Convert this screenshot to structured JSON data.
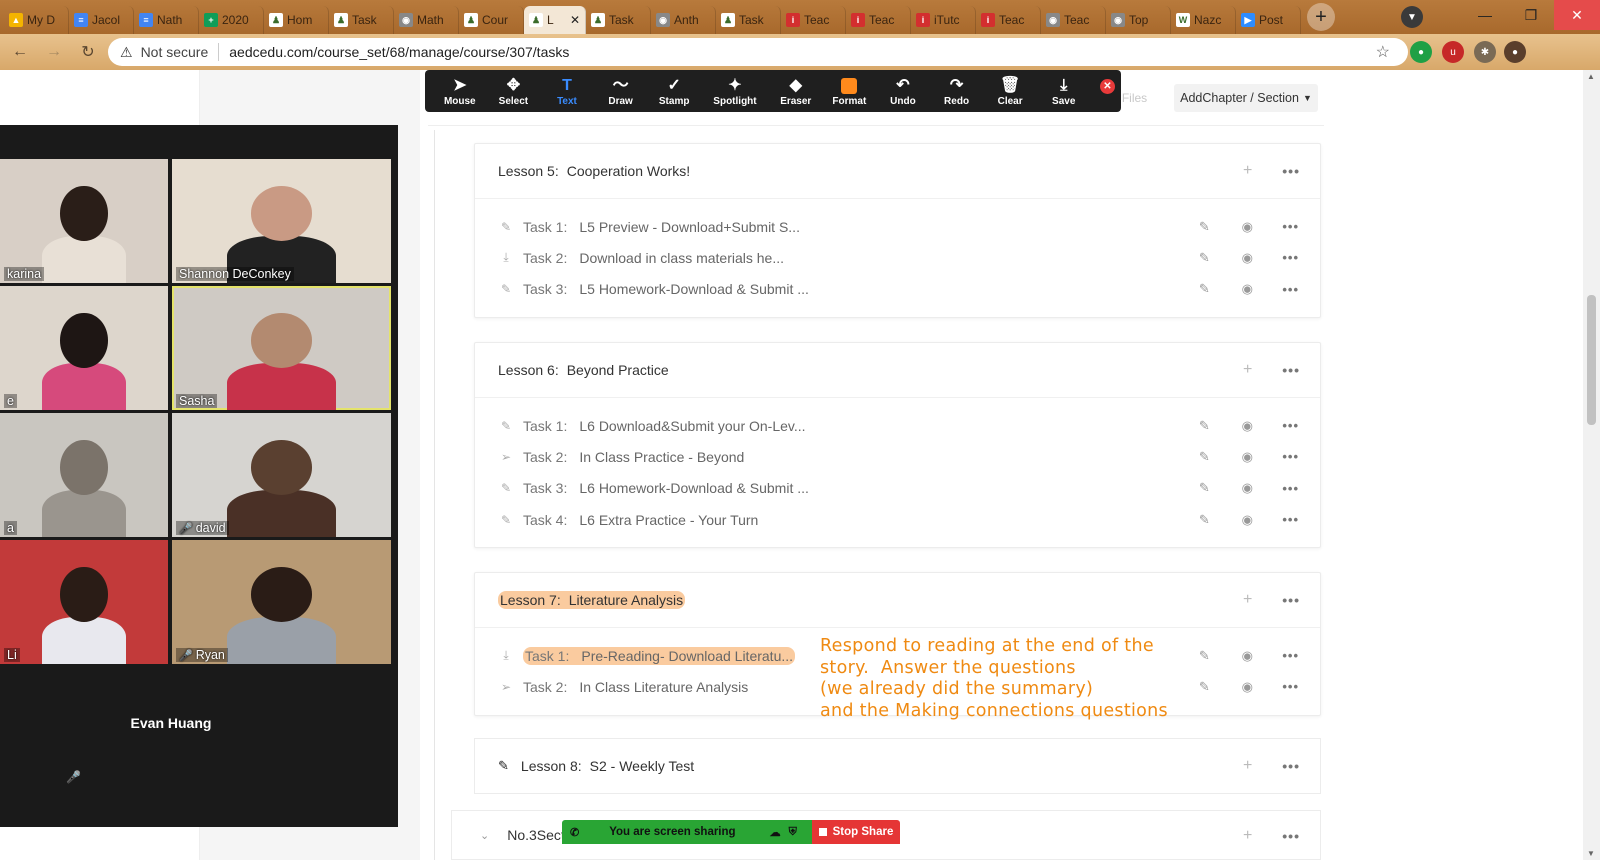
{
  "browser": {
    "tabs": [
      {
        "title": "My D",
        "favicon_color": "#f4b400",
        "favicon_glyph": "▲"
      },
      {
        "title": "Jacol",
        "favicon_color": "#4285f4",
        "favicon_glyph": "≡"
      },
      {
        "title": "Nath",
        "favicon_color": "#4285f4",
        "favicon_glyph": "≡"
      },
      {
        "title": "2020",
        "favicon_color": "#0f9d58",
        "favicon_glyph": "+"
      },
      {
        "title": "Hom",
        "favicon_color": "#ffffff",
        "favicon_glyph": "♟"
      },
      {
        "title": "Task",
        "favicon_color": "#ffffff",
        "favicon_glyph": "♟"
      },
      {
        "title": "Math",
        "favicon_color": "#888888",
        "favicon_glyph": "◉"
      },
      {
        "title": "Cour",
        "favicon_color": "#ffffff",
        "favicon_glyph": "♟"
      },
      {
        "title": "L",
        "favicon_color": "#ffffff",
        "favicon_glyph": "♟",
        "active": true
      },
      {
        "title": "Task",
        "favicon_color": "#ffffff",
        "favicon_glyph": "♟"
      },
      {
        "title": "Anth",
        "favicon_color": "#888888",
        "favicon_glyph": "◉"
      },
      {
        "title": "Task",
        "favicon_color": "#ffffff",
        "favicon_glyph": "♟"
      },
      {
        "title": "Teac",
        "favicon_color": "#d32f2f",
        "favicon_glyph": "i"
      },
      {
        "title": "Teac",
        "favicon_color": "#d32f2f",
        "favicon_glyph": "i"
      },
      {
        "title": "iTutc",
        "favicon_color": "#d32f2f",
        "favicon_glyph": "i"
      },
      {
        "title": "Teac",
        "favicon_color": "#d32f2f",
        "favicon_glyph": "i"
      },
      {
        "title": "Teac",
        "favicon_color": "#888888",
        "favicon_glyph": "◉"
      },
      {
        "title": "Top",
        "favicon_color": "#888888",
        "favicon_glyph": "◉"
      },
      {
        "title": "Nazc",
        "favicon_color": "#ffffff",
        "favicon_glyph": "W"
      },
      {
        "title": "Post",
        "favicon_color": "#2d8cff",
        "favicon_glyph": "▶"
      }
    ],
    "new_tab": "+",
    "not_secure": "Not secure",
    "url": "aedcedu.com/course_set/68/manage/course/307/tasks"
  },
  "annotate_toolbar": {
    "tools": [
      {
        "label": "Mouse",
        "icon": "cursor-icon",
        "glyph": "➤"
      },
      {
        "label": "Select",
        "icon": "move-icon",
        "glyph": "✥"
      },
      {
        "label": "Text",
        "icon": "text-icon",
        "glyph": "T",
        "active": true
      },
      {
        "label": "Draw",
        "icon": "squiggle-icon",
        "glyph": "〜"
      },
      {
        "label": "Stamp",
        "icon": "check-icon",
        "glyph": "✓"
      },
      {
        "label": "Spotlight",
        "icon": "wand-icon",
        "glyph": "✦"
      },
      {
        "label": "Eraser",
        "icon": "eraser-icon",
        "glyph": "◆"
      },
      {
        "label": "Format",
        "icon": "format-icon",
        "glyph": "",
        "color": "#ff8a1c"
      },
      {
        "label": "Undo",
        "icon": "undo-icon",
        "glyph": "↶"
      },
      {
        "label": "Redo",
        "icon": "redo-icon",
        "glyph": "↷"
      },
      {
        "label": "Clear",
        "icon": "trash-icon",
        "glyph": "🗑"
      },
      {
        "label": "Save",
        "icon": "save-icon",
        "glyph": "⤓"
      }
    ]
  },
  "header": {
    "files_label": "Files",
    "add_chapter_label": "AddChapter / Section"
  },
  "lessons": [
    {
      "num": "Lesson 5:",
      "title": "Cooperation Works!",
      "tasks": [
        {
          "icon": "pencil-icon",
          "num": "Task 1:",
          "title": "L5 Preview - Download+Submit S..."
        },
        {
          "icon": "download-icon",
          "num": "Task 2:",
          "title": "Download in class materials he..."
        },
        {
          "icon": "pencil-icon",
          "num": "Task 3:",
          "title": "L5 Homework-Download & Submit ..."
        }
      ]
    },
    {
      "num": "Lesson 6:",
      "title": "Beyond Practice",
      "tasks": [
        {
          "icon": "pencil-icon",
          "num": "Task 1:",
          "title": "L6 Download&Submit your On-Lev..."
        },
        {
          "icon": "send-icon",
          "num": "Task 2:",
          "title": "In Class Practice - Beyond"
        },
        {
          "icon": "pencil-icon",
          "num": "Task 3:",
          "title": "L6 Homework-Download & Submit ..."
        },
        {
          "icon": "pencil-icon",
          "num": "Task 4:",
          "title": "L6 Extra Practice - Your Turn"
        }
      ]
    },
    {
      "num": "Lesson 7:",
      "title": "Literature Analysis",
      "tasks": [
        {
          "icon": "download-icon",
          "num": "Task 1:",
          "title": "Pre-Reading- Download Literatu..."
        },
        {
          "icon": "send-icon",
          "num": "Task 2:",
          "title": "In Class Literature Analysis"
        }
      ]
    }
  ],
  "lesson8": {
    "num": "Lesson 8:",
    "title": "S2 - Weekly Test"
  },
  "section3": {
    "label": "No.3Sect"
  },
  "annotation_text": "Respond to reading at the end of the\nstory.  Answer the questions\n(we already did the summary)\nand the Making connections questions",
  "annotation_color": "#ef8a12",
  "gallery": {
    "tiles": [
      {
        "name": "karina",
        "muted": false
      },
      {
        "name": "Shannon DeConkey",
        "muted": false
      },
      {
        "name": "e",
        "muted": false
      },
      {
        "name": "Sasha",
        "muted": false,
        "speaking": true
      },
      {
        "name": "a",
        "muted": false
      },
      {
        "name": "david",
        "muted": true
      },
      {
        "name": "Li",
        "muted": false
      },
      {
        "name": "Ryan",
        "muted": true
      }
    ],
    "audio_only": {
      "name": "Evan Huang",
      "muted": true
    }
  },
  "share_bar": {
    "sharing_label": "You are screen sharing",
    "stop_label": "Stop Share"
  }
}
